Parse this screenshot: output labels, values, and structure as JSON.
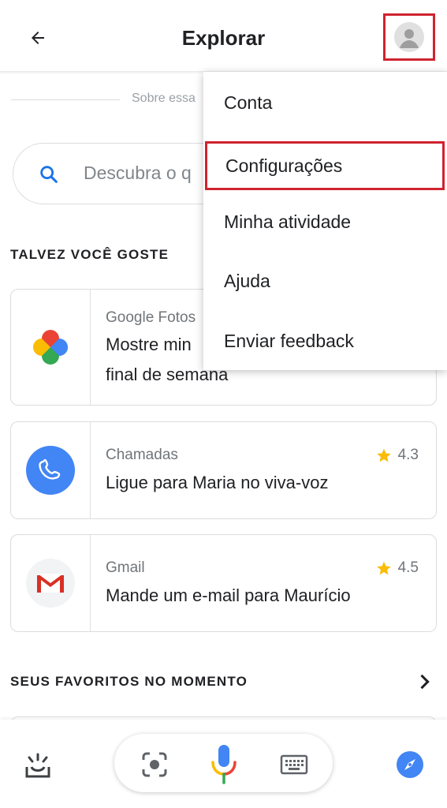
{
  "header": {
    "title": "Explorar",
    "back_icon": "arrow-back-icon",
    "avatar_icon": "account-avatar-icon"
  },
  "about_divider": {
    "text": "Sobre essa"
  },
  "search": {
    "placeholder": "Descubra o q"
  },
  "section_suggestions": {
    "title": "TALVEZ VOCÊ GOSTE"
  },
  "cards": [
    {
      "app": "Google Fotos",
      "command_line1": "Mostre min",
      "command_line2": "final de semana",
      "icon": "google-photos-icon",
      "rating": ""
    },
    {
      "app": "Chamadas",
      "command_line1": "Ligue para Maria no viva-voz",
      "command_line2": "",
      "icon": "phone-icon",
      "rating": "4.3"
    },
    {
      "app": "Gmail",
      "command_line1": "Mande um e-mail para Maurício",
      "command_line2": "",
      "icon": "gmail-icon",
      "rating": "4.5"
    }
  ],
  "section_favorites": {
    "title": "SEUS FAVORITOS NO MOMENTO"
  },
  "menu": {
    "items": [
      {
        "label": "Conta"
      },
      {
        "label": "Configurações"
      },
      {
        "label": "Minha atividade"
      },
      {
        "label": "Ajuda"
      },
      {
        "label": "Enviar feedback"
      }
    ],
    "highlighted": "Configurações"
  },
  "bottom_bar": {
    "icons": [
      "snapshot-icon",
      "lens-icon",
      "mic-icon",
      "keyboard-icon",
      "explore-compass-icon"
    ]
  },
  "colors": {
    "highlight": "#d0232f",
    "google_blue": "#4285f4",
    "star": "#fbbc04"
  }
}
